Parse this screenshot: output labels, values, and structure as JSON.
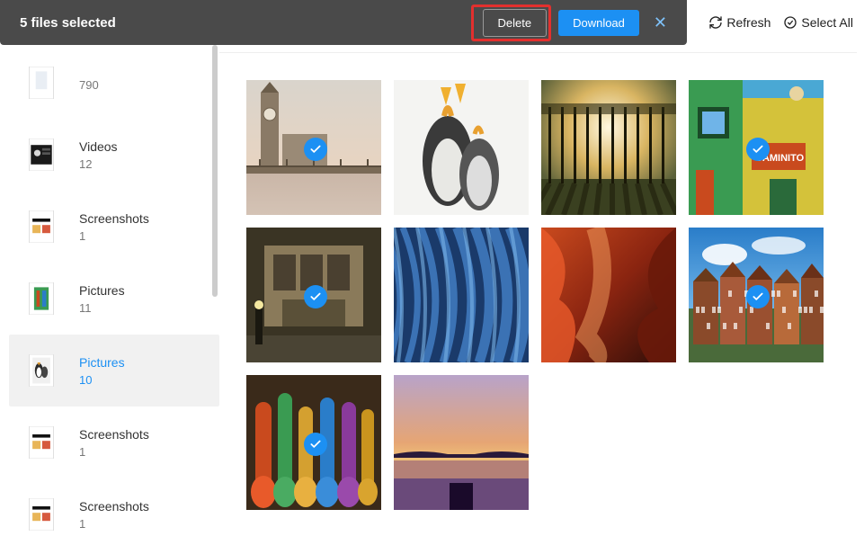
{
  "selectionBar": {
    "countLabel": "5 files selected",
    "deleteLabel": "Delete",
    "downloadLabel": "Download"
  },
  "toolbar": {
    "refreshLabel": "Refresh",
    "selectAllLabel": "Select All"
  },
  "sidebar": {
    "items": [
      {
        "name": "",
        "count": "790",
        "active": false,
        "thumb": "generic"
      },
      {
        "name": "Videos",
        "count": "12",
        "active": false,
        "thumb": "videos"
      },
      {
        "name": "Screenshots",
        "count": "1",
        "active": false,
        "thumb": "screenshot"
      },
      {
        "name": "Pictures",
        "count": "11",
        "active": false,
        "thumb": "pictures-building"
      },
      {
        "name": "Pictures",
        "count": "10",
        "active": true,
        "thumb": "pictures-penguin"
      },
      {
        "name": "Screenshots",
        "count": "1",
        "active": false,
        "thumb": "screenshot"
      },
      {
        "name": "Screenshots",
        "count": "1",
        "active": false,
        "thumb": "screenshot"
      }
    ]
  },
  "grid": {
    "items": [
      {
        "id": "bigben",
        "selected": true
      },
      {
        "id": "penguins",
        "selected": false
      },
      {
        "id": "trees",
        "selected": false
      },
      {
        "id": "caminito",
        "selected": true
      },
      {
        "id": "copenhagen",
        "selected": true
      },
      {
        "id": "blue-fabric",
        "selected": false
      },
      {
        "id": "canyon",
        "selected": false
      },
      {
        "id": "amsterdam",
        "selected": true
      },
      {
        "id": "hookah",
        "selected": true
      },
      {
        "id": "sunset-lake",
        "selected": false
      }
    ]
  }
}
